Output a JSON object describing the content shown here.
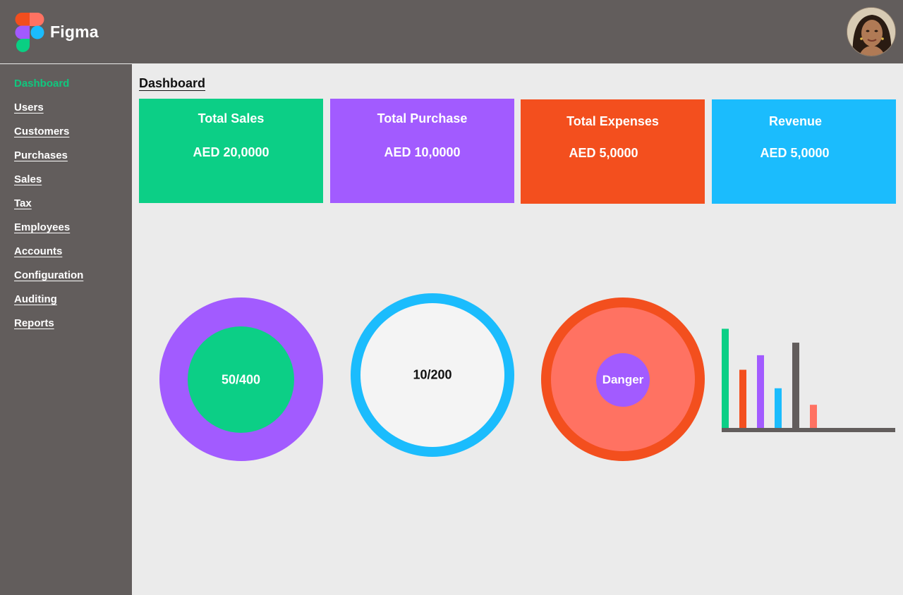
{
  "app": {
    "brand": "Figma"
  },
  "sidebar": {
    "items": [
      {
        "label": "Dashboard",
        "active": true
      },
      {
        "label": "Users"
      },
      {
        "label": "Customers"
      },
      {
        "label": "Purchases"
      },
      {
        "label": "Sales"
      },
      {
        "label": "Tax"
      },
      {
        "label": "Employees"
      },
      {
        "label": "Accounts"
      },
      {
        "label": "Configuration"
      },
      {
        "label": "Auditing"
      },
      {
        "label": "Reports"
      }
    ]
  },
  "main": {
    "title": "Dashboard",
    "cards": [
      {
        "title": "Total Sales",
        "value": "AED 20,0000",
        "color": "#0ccf86"
      },
      {
        "title": "Total Purchase",
        "value": "AED 10,0000",
        "color": "#a25bff"
      },
      {
        "title": "Total Expenses",
        "value": "AED 5,0000",
        "color": "#f34f1e"
      },
      {
        "title": "Revenue",
        "value": "AED 5,0000",
        "color": "#1bbcfd"
      }
    ],
    "gauges": [
      {
        "label": "50/400",
        "outer_color": "#a25bff",
        "inner_color": "#0ccf86"
      },
      {
        "label": "10/200",
        "ring_color": "#1bbcfd",
        "fill_color": "#f4f4f4"
      },
      {
        "label": "Danger",
        "outer_color": "#f34f1e",
        "mid_color": "#ff7262",
        "inner_color": "#a25bff"
      }
    ]
  },
  "chart_data": {
    "type": "bar",
    "values": [
      150,
      88,
      110,
      60,
      129,
      35
    ],
    "colors": [
      "#0ccf86",
      "#f34f1e",
      "#a25bff",
      "#1bbcfd",
      "#625d5c",
      "#ff7262"
    ],
    "ylim": [
      0,
      160
    ]
  }
}
